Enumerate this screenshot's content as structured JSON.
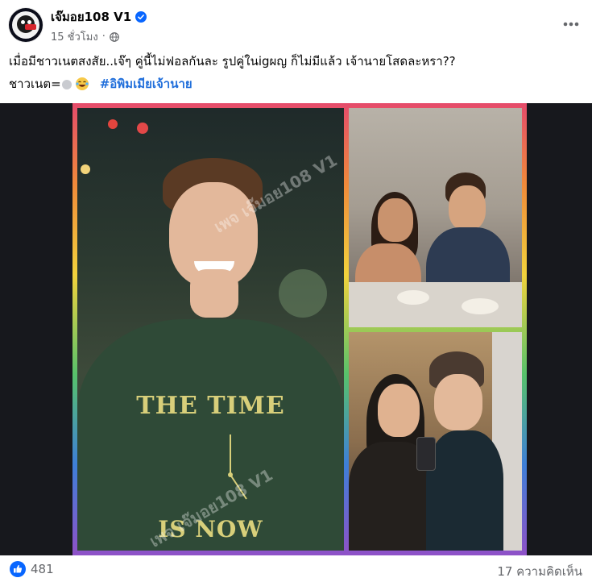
{
  "post": {
    "author_name": "เจ๊มอย108 V1",
    "time": "15 ชั่วโมง",
    "body_line1": "เมื่อมีชาวเนตสงสัย..เจ๊ๆ คู่นี้ไม่ฟอลกันละ รูปคู่ในigผญ ก็ไม่มีแล้ว เจ้านายโสดละหรา??",
    "body_line2_prefix": "ชาวเนต=",
    "hashtag": "#อิพิมเมียเจ้านาย",
    "image": {
      "shirt_text_top": "THE TIME",
      "shirt_text_bottom": "IS NOW",
      "watermark": "เพจ เจ๊มอย108 V1"
    }
  },
  "footer": {
    "likes": "481",
    "comments": "17 ความคิดเห็น"
  },
  "icons": {
    "verified": "verified-badge-icon",
    "audience": "globe-icon",
    "more": "more-options-icon",
    "reaction": "like-reaction-icon"
  },
  "colors": {
    "accent_blue": "#0866ff",
    "hashtag": "#216fdb",
    "secondary_text": "#65676b"
  }
}
